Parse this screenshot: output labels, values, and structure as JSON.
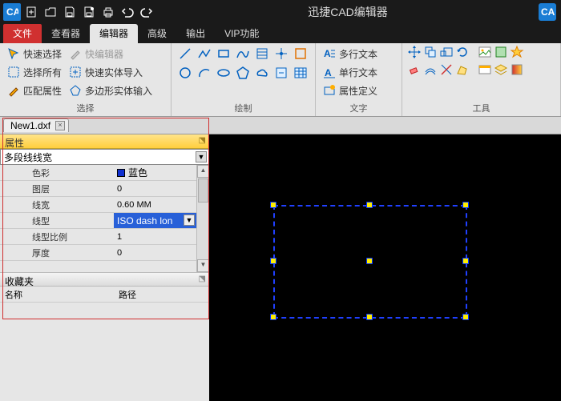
{
  "title": "迅捷CAD编辑器",
  "menu": {
    "file": "文件",
    "viewer": "查看器",
    "editor": "编辑器",
    "advanced": "高级",
    "output": "输出",
    "vip": "VIP功能"
  },
  "ribbon": {
    "sel": {
      "quick": "快速选择",
      "all": "选择所有",
      "match": "匹配属性",
      "quickEd": "快编辑器",
      "impEnt": "快速实体导入",
      "polyEnt": "多边形实体输入",
      "label": "选择"
    },
    "draw": {
      "label": "绘制"
    },
    "text": {
      "mtext": "多行文本",
      "stext": "单行文本",
      "attdef": "属性定义",
      "label": "文字"
    },
    "tools": {
      "label": "工具"
    }
  },
  "fileTab": "New1.dxf",
  "panel": {
    "title": "属性",
    "combo": "多段线线宽",
    "rows": {
      "color": {
        "n": "色彩",
        "v": "蓝色"
      },
      "layer": {
        "n": "图层",
        "v": "0"
      },
      "lw": {
        "n": "线宽",
        "v": "0.60 MM"
      },
      "lt": {
        "n": "线型",
        "v": "ISO dash lon"
      },
      "lts": {
        "n": "线型比例",
        "v": "1"
      },
      "thk": {
        "n": "厚度",
        "v": "0"
      }
    },
    "fav": "收藏夹",
    "favName": "名称",
    "favPath": "路径"
  }
}
